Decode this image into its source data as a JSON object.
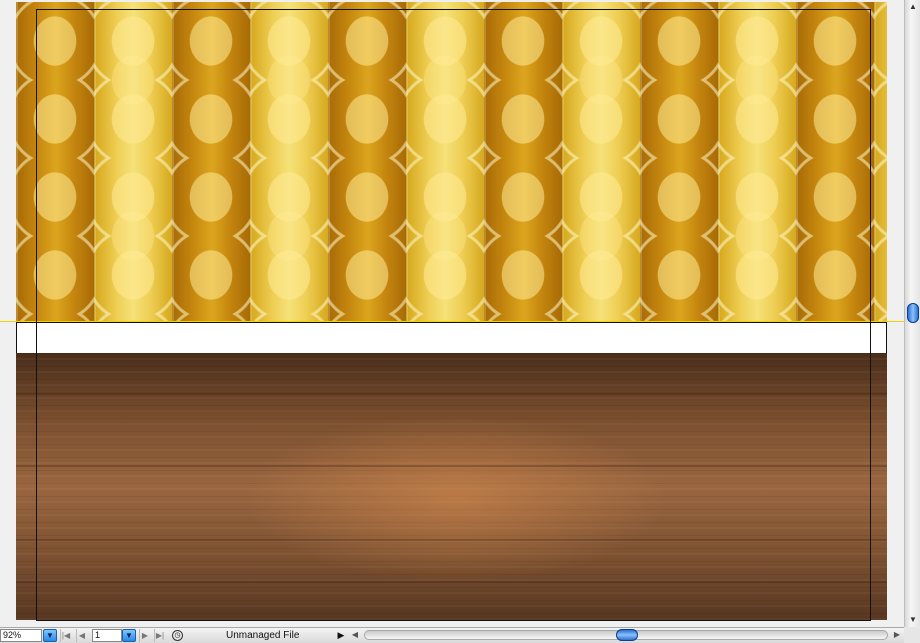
{
  "document": {
    "top_image": "wallpaper-pattern",
    "bottom_image": "wood-texture"
  },
  "statusbar": {
    "zoom": "92%",
    "page_number": "1",
    "file_status": "Unmanaged File"
  },
  "icons": {
    "zoom_dropdown": "chevron-down-icon",
    "first_page": "first-page-icon",
    "prev_page": "prev-page-icon",
    "page_dropdown": "chevron-down-icon",
    "next_page": "next-page-icon",
    "last_page": "last-page-icon",
    "status": "preflight-icon",
    "status_menu": "play-triangle-icon"
  },
  "colors": {
    "scroll_thumb": "#1b5fc4",
    "guide": "#f2d200"
  }
}
